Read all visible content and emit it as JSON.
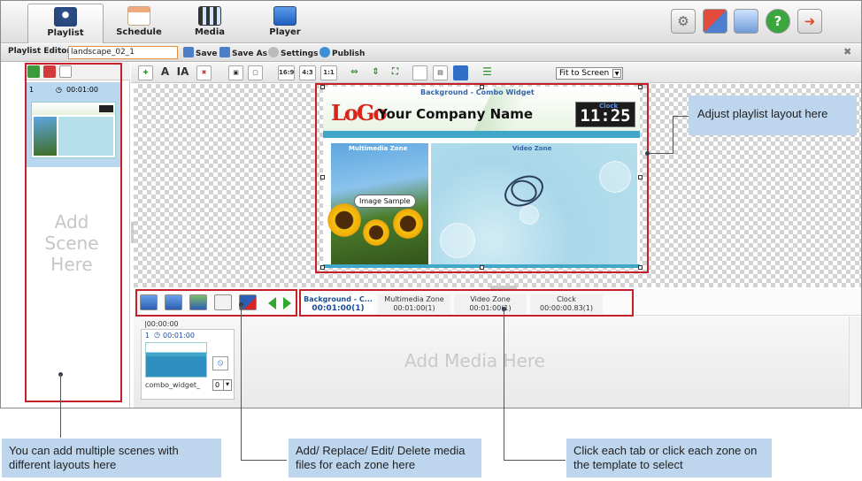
{
  "nav": {
    "tabs": [
      {
        "label": "Playlist",
        "icon": "playlist-icon"
      },
      {
        "label": "Schedule",
        "icon": "calendar-icon"
      },
      {
        "label": "Media",
        "icon": "film-icon"
      },
      {
        "label": "Player",
        "icon": "monitor-icon"
      }
    ],
    "right_icons": [
      "settings-icon",
      "display-icon",
      "screen-icon",
      "help-icon",
      "logout-icon"
    ]
  },
  "editor": {
    "label": "Playlist Editor -",
    "playlist_name": "landscape_02_1",
    "save": "Save",
    "save_as": "Save As",
    "settings": "Settings",
    "publish": "Publish",
    "close": "✖"
  },
  "scene": {
    "number": "1",
    "duration": "00:01:00",
    "placeholder": [
      "Add",
      "Scene",
      "Here"
    ]
  },
  "toolbar": {
    "aspect_buttons": [
      "16:9",
      "4:3",
      "1:1"
    ],
    "fit_select": "Fit to Screen"
  },
  "template": {
    "bg_title": "Background - Combo Widget",
    "logo": "LoGo",
    "company": "Your Company Name",
    "clock_label": "Clock",
    "clock_time": "11:25",
    "mm_zone_label": "Multimedia Zone",
    "image_sample": "Image Sample",
    "video_zone_label": "Video Zone"
  },
  "zone_tabs": [
    {
      "title": "Background - C...",
      "time": "00:01:00(1)",
      "active": true
    },
    {
      "title": "Multimedia Zone",
      "time": "00:01:00(1)",
      "active": false
    },
    {
      "title": "Video Zone",
      "time": "00:01:00(1)",
      "active": false
    },
    {
      "title": "Clock",
      "time": "00:00:00.83(1)",
      "active": false
    }
  ],
  "media": {
    "timecode": "|00:00:00",
    "item_number": "1",
    "item_duration": "00:01:00",
    "item_name": "combo_widget_",
    "order_value": "0",
    "placeholder": "Add Media Here"
  },
  "callouts": {
    "layout": "Adjust playlist layout here",
    "scenes": "You can add multiple scenes with different layouts here",
    "media": "Add/ Replace/ Edit/ Delete media files for each zone here",
    "tabs": "Click each tab or click each zone on the template to select"
  },
  "colors": {
    "highlight_red": "#c8202b",
    "callout_blue": "#bdd6ee",
    "zone_band": "#41a7c9"
  }
}
